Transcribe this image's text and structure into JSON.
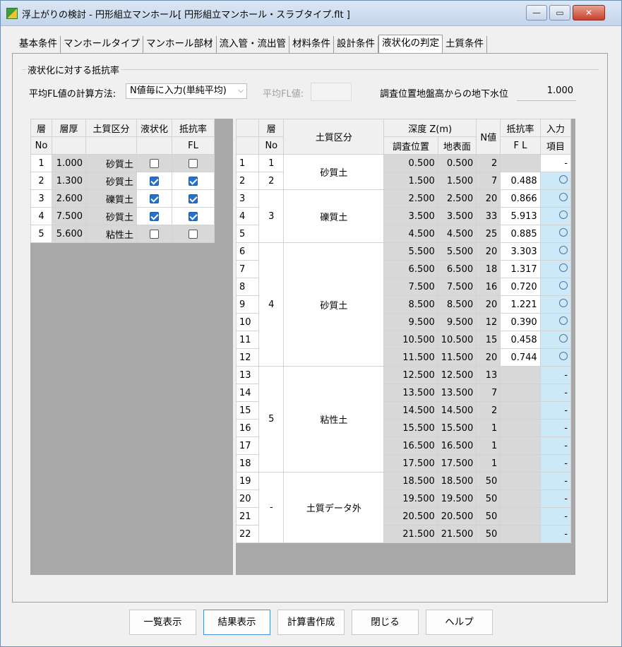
{
  "window": {
    "title": "浮上がりの検討 - 円形組立マンホール[ 円形組立マンホール・スラブタイプ.flt ]",
    "min_label": "—",
    "max_label": "▭",
    "close_label": "✕"
  },
  "tabs": [
    "基本条件",
    "マンホールタイプ",
    "マンホール部材",
    "流入管・流出管",
    "材料条件",
    "設計条件",
    "液状化の判定",
    "土質条件"
  ],
  "active_tab": "液状化の判定",
  "group_title": "液状化に対する抵抗率",
  "calc_method_label": "平均FL値の計算方法:",
  "calc_method_value": "N値毎に入力(単純平均)",
  "avg_fl_label": "平均FL値:",
  "gw_label": "調査位置地盤高からの地下水位",
  "gw_value": "1.000",
  "left_grid": {
    "headers": [
      "層",
      "層厚",
      "土質区分",
      "液状化",
      "抵抗率"
    ],
    "subheaders": [
      "No",
      "",
      "",
      "",
      "FL"
    ],
    "rows": [
      {
        "no": "1",
        "thickness": "1.000",
        "soil": "砂質土",
        "liq": false,
        "fl": false,
        "enabled": false
      },
      {
        "no": "2",
        "thickness": "1.300",
        "soil": "砂質土",
        "liq": true,
        "fl": true,
        "enabled": true
      },
      {
        "no": "3",
        "thickness": "2.600",
        "soil": "礫質土",
        "liq": true,
        "fl": true,
        "enabled": true
      },
      {
        "no": "4",
        "thickness": "7.500",
        "soil": "砂質土",
        "liq": true,
        "fl": true,
        "enabled": true
      },
      {
        "no": "5",
        "thickness": "5.600",
        "soil": "粘性土",
        "liq": false,
        "fl": false,
        "enabled": false
      }
    ]
  },
  "right_grid": {
    "headers": [
      "層",
      "土質区分",
      "深度 Z(m)",
      "N値",
      "抵抗率",
      "入力"
    ],
    "subheaders": [
      "No",
      "調査位置",
      "地表面",
      "F L",
      "項目"
    ],
    "layers": [
      {
        "no": "1",
        "soil": "砂質土",
        "span": 1
      },
      {
        "no": "2",
        "soil": "",
        "span": 1
      },
      {
        "no": "3",
        "soil": "礫質土",
        "span": 3
      },
      {
        "no": "4",
        "soil": "砂質土",
        "span": 7
      },
      {
        "no": "5",
        "soil": "粘性土",
        "span": 6
      },
      {
        "no": "-",
        "soil": "土質データ外",
        "span": 4
      }
    ],
    "rows": [
      {
        "idx": "1",
        "z1": "0.500",
        "z2": "0.500",
        "n": "2",
        "fl": "",
        "mark": "-"
      },
      {
        "idx": "2",
        "z1": "1.500",
        "z2": "1.500",
        "n": "7",
        "fl": "0.488",
        "mark": "○"
      },
      {
        "idx": "3",
        "z1": "2.500",
        "z2": "2.500",
        "n": "20",
        "fl": "0.866",
        "mark": "○"
      },
      {
        "idx": "4",
        "z1": "3.500",
        "z2": "3.500",
        "n": "33",
        "fl": "5.913",
        "mark": "○"
      },
      {
        "idx": "5",
        "z1": "4.500",
        "z2": "4.500",
        "n": "25",
        "fl": "0.885",
        "mark": "○"
      },
      {
        "idx": "6",
        "z1": "5.500",
        "z2": "5.500",
        "n": "20",
        "fl": "3.303",
        "mark": "○"
      },
      {
        "idx": "7",
        "z1": "6.500",
        "z2": "6.500",
        "n": "18",
        "fl": "1.317",
        "mark": "○"
      },
      {
        "idx": "8",
        "z1": "7.500",
        "z2": "7.500",
        "n": "16",
        "fl": "0.720",
        "mark": "○"
      },
      {
        "idx": "9",
        "z1": "8.500",
        "z2": "8.500",
        "n": "20",
        "fl": "1.221",
        "mark": "○"
      },
      {
        "idx": "10",
        "z1": "9.500",
        "z2": "9.500",
        "n": "12",
        "fl": "0.390",
        "mark": "○"
      },
      {
        "idx": "11",
        "z1": "10.500",
        "z2": "10.500",
        "n": "15",
        "fl": "0.458",
        "mark": "○"
      },
      {
        "idx": "12",
        "z1": "11.500",
        "z2": "11.500",
        "n": "20",
        "fl": "0.744",
        "mark": "○"
      },
      {
        "idx": "13",
        "z1": "12.500",
        "z2": "12.500",
        "n": "13",
        "fl": "",
        "mark": "-"
      },
      {
        "idx": "14",
        "z1": "13.500",
        "z2": "13.500",
        "n": "7",
        "fl": "",
        "mark": "-"
      },
      {
        "idx": "15",
        "z1": "14.500",
        "z2": "14.500",
        "n": "2",
        "fl": "",
        "mark": "-"
      },
      {
        "idx": "16",
        "z1": "15.500",
        "z2": "15.500",
        "n": "1",
        "fl": "",
        "mark": "-"
      },
      {
        "idx": "17",
        "z1": "16.500",
        "z2": "16.500",
        "n": "1",
        "fl": "",
        "mark": "-"
      },
      {
        "idx": "18",
        "z1": "17.500",
        "z2": "17.500",
        "n": "1",
        "fl": "",
        "mark": "-"
      },
      {
        "idx": "19",
        "z1": "18.500",
        "z2": "18.500",
        "n": "50",
        "fl": "",
        "mark": "-"
      },
      {
        "idx": "20",
        "z1": "19.500",
        "z2": "19.500",
        "n": "50",
        "fl": "",
        "mark": "-"
      },
      {
        "idx": "21",
        "z1": "20.500",
        "z2": "20.500",
        "n": "50",
        "fl": "",
        "mark": "-"
      },
      {
        "idx": "22",
        "z1": "21.500",
        "z2": "21.500",
        "n": "50",
        "fl": "",
        "mark": "-"
      }
    ]
  },
  "buttons": {
    "list": "一覧表示",
    "result": "結果表示",
    "report": "計算書作成",
    "close": "閉じる",
    "help": "ヘルプ"
  }
}
